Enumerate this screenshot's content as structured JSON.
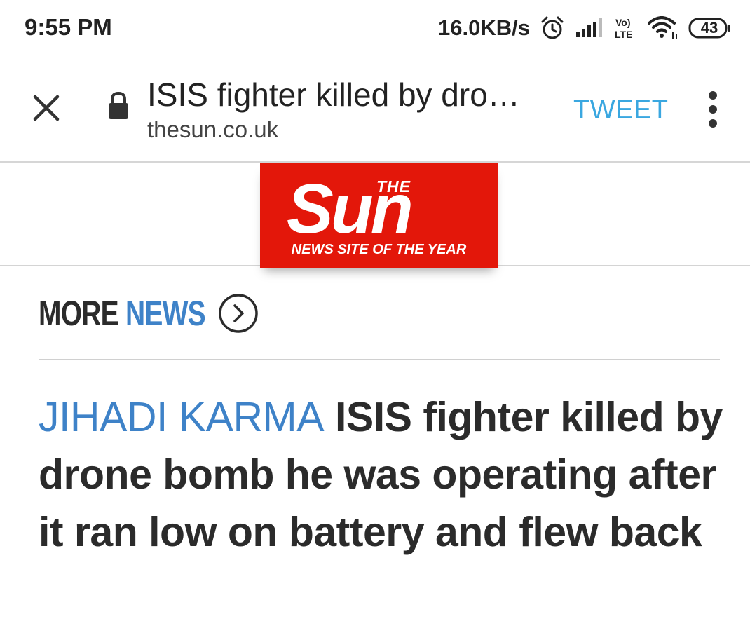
{
  "status_bar": {
    "time": "9:55 PM",
    "network_speed": "16.0KB/s",
    "battery_level": "43",
    "icons": [
      "alarm-icon",
      "signal-icon",
      "volte-icon",
      "wifi-icon",
      "battery-icon"
    ]
  },
  "toolbar": {
    "title": "ISIS fighter killed by dro…",
    "url": "thesun.co.uk",
    "tweet_label": "TWEET",
    "icons": [
      "close-icon",
      "lock-icon",
      "overflow-menu-icon"
    ],
    "tweet_color": "#3aa7e0"
  },
  "logo": {
    "the": "THE",
    "name": "Sun",
    "tagline": "NEWS SITE OF THE YEAR",
    "background_color": "#e3170a"
  },
  "more_news": {
    "word1": "MORE",
    "word2": "NEWS",
    "accent_color": "#3e82c8",
    "icon": "chevron-right-circle-icon"
  },
  "article": {
    "kicker": "JIHADI KARMA",
    "headline": "ISIS fighter killed by drone bomb he was operating after it ran low on battery and flew back"
  }
}
